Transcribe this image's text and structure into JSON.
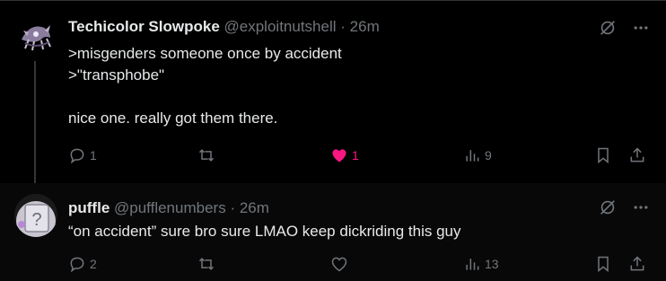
{
  "colors": {
    "background": "#000000",
    "text_primary": "#e7e9ea",
    "text_secondary": "#71767b",
    "like_active": "#f91880"
  },
  "tweets": [
    {
      "name": "Techicolor Slowpoke",
      "handle": "@exploitnutshell",
      "separator": "·",
      "time": "26m",
      "avatar_icon": "dark-creature-avatar",
      "text": ">misgenders someone once by accident\n>\"transphobe\"\n\nnice one. really got them there.",
      "replies": "1",
      "retweets": "",
      "likes": "1",
      "liked": true,
      "views": "9"
    },
    {
      "name": "puffle",
      "handle": "@pufflenumbers",
      "separator": "·",
      "time": "26m",
      "avatar_icon": "puffle-avatar",
      "text": "“on accident” sure bro sure LMAO keep dickriding this guy",
      "replies": "2",
      "retweets": "",
      "likes": "",
      "liked": false,
      "views": "13"
    }
  ]
}
